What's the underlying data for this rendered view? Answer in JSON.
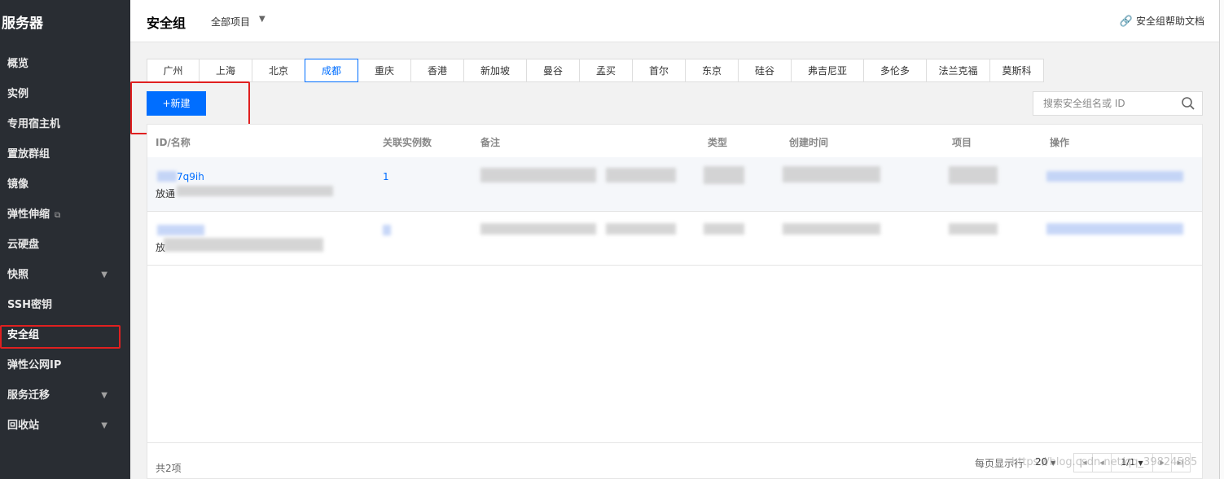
{
  "sidebar": {
    "title": "服务器",
    "items": [
      {
        "label": "概览"
      },
      {
        "label": "实例"
      },
      {
        "label": "专用宿主机"
      },
      {
        "label": "置放群组"
      },
      {
        "label": "镜像"
      },
      {
        "label": "弹性伸缩"
      },
      {
        "label": "云硬盘"
      },
      {
        "label": "快照"
      },
      {
        "label": "SSH密钥"
      },
      {
        "label": "安全组"
      },
      {
        "label": "弹性公网IP"
      },
      {
        "label": "服务迁移"
      },
      {
        "label": "回收站"
      }
    ],
    "active": "安全组"
  },
  "header": {
    "title": "安全组",
    "project": "全部项目",
    "help": "安全组帮助文档"
  },
  "regions": [
    "广州",
    "上海",
    "北京",
    "成都",
    "重庆",
    "香港",
    "新加坡",
    "曼谷",
    "孟买",
    "首尔",
    "东京",
    "硅谷",
    "弗吉尼亚",
    "多伦多",
    "法兰克福",
    "莫斯科"
  ],
  "active_region": "成都",
  "toolbar": {
    "new_label": "+新建",
    "search_placeholder": "搜索安全组名或 ID"
  },
  "table": {
    "columns": [
      "ID/名称",
      "关联实例数",
      "备注",
      "类型",
      "创建时间",
      "项目",
      "操作"
    ],
    "rows": [
      {
        "id_partial": "7q9ih",
        "name_partial": "放通",
        "count": "1"
      },
      {
        "id_partial": "",
        "name_partial": "放",
        "count": ""
      }
    ],
    "total": "共2项",
    "per_page_label": "每页显示行",
    "per_page": "20",
    "page": "1/1"
  },
  "watermark": "https://blog.csdn.net/qq_39824585",
  "colors": {
    "accent": "#006eff",
    "sidebar_bg": "#292d33",
    "highlight": "#e02020"
  }
}
